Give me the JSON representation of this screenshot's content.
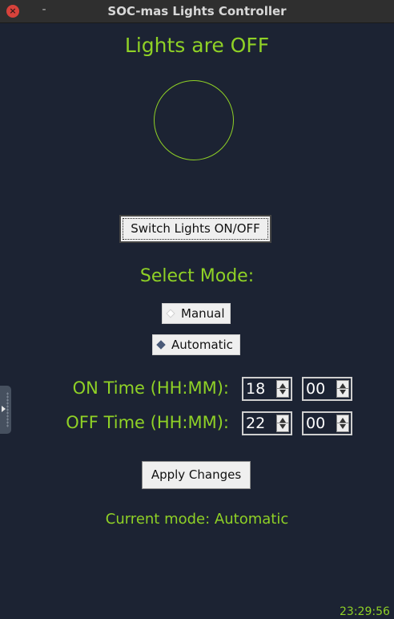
{
  "window": {
    "title": "SOC-mas Lights Controller",
    "close_icon": "close-icon",
    "minimize_icon": "minimize-icon",
    "close_glyph": "×",
    "minimize_glyph": "-"
  },
  "status": {
    "text": "Lights are OFF",
    "indicator_icon": "light-status-circle",
    "indicator_color": "#8fd126"
  },
  "controls": {
    "switch_label": "Switch Lights ON/OFF",
    "select_mode_label": "Select Mode:",
    "modes": [
      {
        "label": "Manual",
        "selected": false
      },
      {
        "label": "Automatic",
        "selected": true
      }
    ],
    "on_time_label": "ON Time (HH:MM):",
    "on_hour": "18",
    "on_minute": "00",
    "off_time_label": "OFF Time (HH:MM):",
    "off_hour": "22",
    "off_minute": "00",
    "apply_label": "Apply Changes",
    "current_mode_text": "Current mode: Automatic"
  },
  "clock": "23:29:56",
  "colors": {
    "background": "#1c2333",
    "accent": "#8fd126",
    "titlebar": "#2f2f2f",
    "close": "#d7423b"
  }
}
